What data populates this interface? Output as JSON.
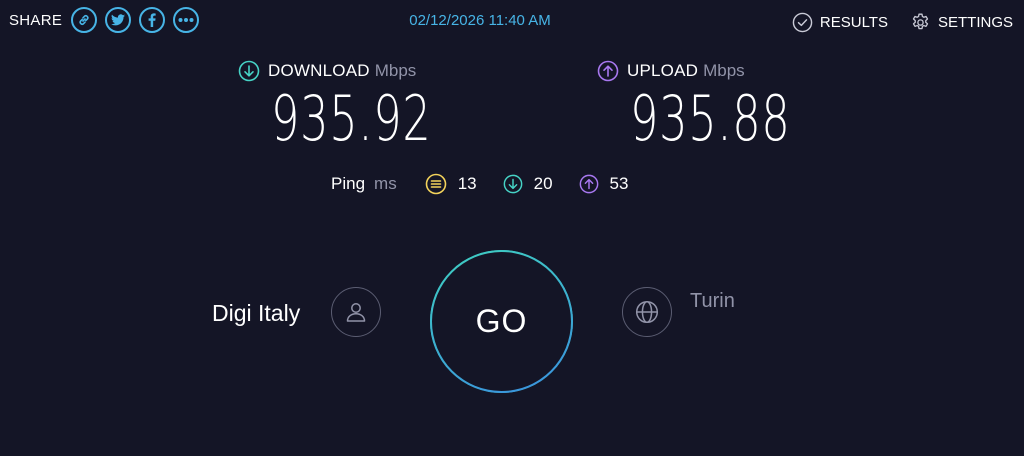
{
  "header": {
    "share_label": "SHARE",
    "share_buttons": [
      {
        "icon": "link-icon"
      },
      {
        "icon": "twitter-icon"
      },
      {
        "icon": "facebook-icon"
      },
      {
        "icon": "more-icon"
      }
    ],
    "datetime": "02/12/2026 11:40 AM",
    "results_label": "RESULTS",
    "settings_label": "SETTINGS"
  },
  "download": {
    "label": "DOWNLOAD",
    "unit": "Mbps",
    "value": "935.92",
    "color": "#46d3c6"
  },
  "upload": {
    "label": "UPLOAD",
    "unit": "Mbps",
    "value": "935.88",
    "color": "#a878f0"
  },
  "ping": {
    "label": "Ping",
    "unit": "ms",
    "idle": "13",
    "download": "20",
    "upload": "53",
    "idle_color": "#f3d35b"
  },
  "server": {
    "isp": "Digi Italy",
    "location": "Turin"
  },
  "go": {
    "label": "GO"
  },
  "colors": {
    "background": "#141526",
    "accent": "#47b4e6"
  }
}
